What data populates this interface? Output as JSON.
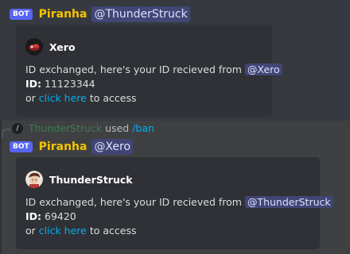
{
  "messages": [
    {
      "bot_tag": "BOT",
      "author": "Piranha",
      "mention": "@ThunderStruck",
      "embed": {
        "author_name": "Xero",
        "line1_prefix": "ID exchanged, here's your ID recieved from",
        "line1_mention": "@Xero",
        "id_label": "ID:",
        "id_value": "11123344",
        "access_prefix": "or",
        "access_link": "click here",
        "access_suffix": "to access"
      }
    },
    {
      "bot_tag": "BOT",
      "author": "Piranha",
      "mention": "@Xero",
      "embed": {
        "author_name": "ThunderStruck",
        "line1_prefix": "ID exchanged, here's your ID recieved from",
        "line1_mention": "@ThunderStruck",
        "id_label": "ID:",
        "id_value": "69420",
        "access_prefix": "or",
        "access_link": "click here",
        "access_suffix": "to access"
      }
    }
  ],
  "reply": {
    "icon": "/",
    "user": "ThunderStruck",
    "used": "used",
    "command": "/ban"
  },
  "colors": {
    "background": "#36393f",
    "highlight": "#3f4042",
    "embed": "#2f3136",
    "author": "#f5c400",
    "mention_bg": "#414675",
    "link": "#00aff4",
    "bot_tag": "#5865f2"
  }
}
